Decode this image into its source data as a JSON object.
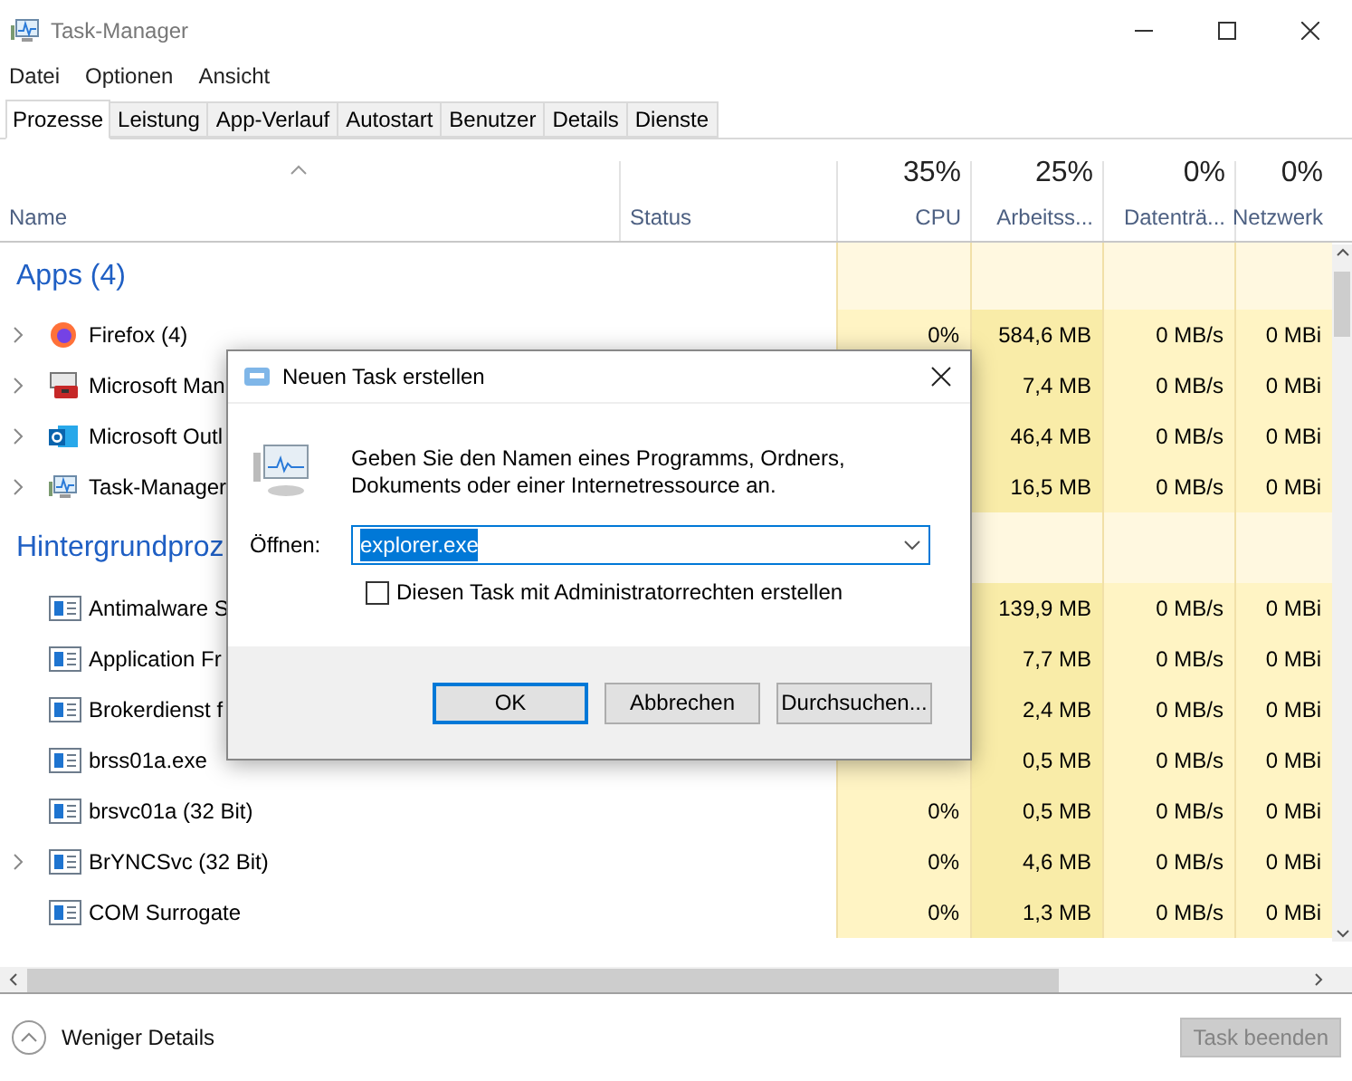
{
  "window": {
    "title": "Task-Manager"
  },
  "menu": [
    "Datei",
    "Optionen",
    "Ansicht"
  ],
  "tabs": [
    {
      "label": "Prozesse",
      "selected": true
    },
    {
      "label": "Leistung",
      "selected": false
    },
    {
      "label": "App-Verlauf",
      "selected": false
    },
    {
      "label": "Autostart",
      "selected": false
    },
    {
      "label": "Benutzer",
      "selected": false
    },
    {
      "label": "Details",
      "selected": false
    },
    {
      "label": "Dienste",
      "selected": false
    }
  ],
  "columns": [
    {
      "label": "Name"
    },
    {
      "label": "Status"
    },
    {
      "label": "CPU",
      "total": "35%"
    },
    {
      "label": "Arbeitss...",
      "total": "25%"
    },
    {
      "label": "Datenträ...",
      "total": "0%"
    },
    {
      "label": "Netzwerk",
      "total": "0%"
    }
  ],
  "groups": [
    {
      "title": "Apps (4)",
      "rows": [
        {
          "name": "Firefox (4)",
          "expandable": true,
          "cpu": "0%",
          "memory": "584,6 MB",
          "disk": "0 MB/s",
          "network": "0 MBi"
        },
        {
          "name": "Microsoft Man",
          "expandable": true,
          "memory": "7,4 MB",
          "disk": "0 MB/s",
          "network": "0 MBi"
        },
        {
          "name": "Microsoft Outl",
          "expandable": true,
          "memory": "46,4 MB",
          "disk": "0 MB/s",
          "network": "0 MBi"
        },
        {
          "name": "Task-Manager",
          "expandable": true,
          "memory": "16,5 MB",
          "disk": "0 MB/s",
          "network": "0 MBi"
        }
      ]
    },
    {
      "title": "Hintergrundproz",
      "rows": [
        {
          "name": "Antimalware S",
          "expandable": false,
          "memory": "139,9 MB",
          "disk": "0 MB/s",
          "network": "0 MBi"
        },
        {
          "name": "Application Fr",
          "expandable": false,
          "memory": "7,7 MB",
          "disk": "0 MB/s",
          "network": "0 MBi"
        },
        {
          "name": "Brokerdienst f",
          "expandable": false,
          "memory": "2,4 MB",
          "disk": "0 MB/s",
          "network": "0 MBi"
        },
        {
          "name": "brss01a.exe",
          "expandable": false,
          "memory": "0,5 MB",
          "disk": "0 MB/s",
          "network": "0 MBi"
        },
        {
          "name": "brsvc01a (32 Bit)",
          "expandable": false,
          "cpu": "0%",
          "memory": "0,5 MB",
          "disk": "0 MB/s",
          "network": "0 MBi"
        },
        {
          "name": "BrYNCSvc (32 Bit)",
          "expandable": true,
          "cpu": "0%",
          "memory": "4,6 MB",
          "disk": "0 MB/s",
          "network": "0 MBi"
        },
        {
          "name": "COM Surrogate",
          "expandable": false,
          "cpu": "0%",
          "memory": "1,3 MB",
          "disk": "0 MB/s",
          "network": "0 MBi"
        }
      ]
    }
  ],
  "footer": {
    "details_link": "Weniger Details",
    "end_task": {
      "label": "Task beenden",
      "disabled": true
    }
  },
  "dialog": {
    "title": "Neuen Task erstellen",
    "message": "Geben Sie den Namen eines Programms, Ordners, Dokuments oder einer Internetressource an.",
    "open_label": "Öffnen:",
    "open_value": "explorer.exe",
    "value_selected": true,
    "admin_checkbox": {
      "label": "Diesen Task mit Administratorrechten erstellen",
      "checked": false
    },
    "buttons": [
      {
        "label": "OK",
        "default": true
      },
      {
        "label": "Abbrechen",
        "default": false
      },
      {
        "label": "Durchsuchen...",
        "default": false
      }
    ]
  }
}
